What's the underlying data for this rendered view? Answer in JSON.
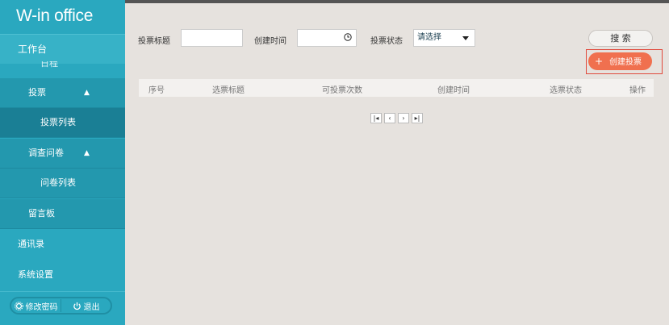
{
  "sidebar": {
    "logo": "W-in office",
    "top_item": "工作台",
    "cut_item": "日程",
    "vote_section": {
      "label": "投票",
      "arrow": "▲"
    },
    "vote_list": "投票列表",
    "survey_section": {
      "label": "调查问卷",
      "arrow": "▲"
    },
    "survey_list": "问卷列表",
    "message_board": "留言板",
    "contacts": "通讯录",
    "settings": "系统设置",
    "footer": {
      "change_password": "修改密码",
      "logout": "退出"
    }
  },
  "filters": {
    "title_label": "投票标题",
    "title_value": "",
    "time_label": "创建时间",
    "time_value": "",
    "status_label": "投票状态",
    "status_selected": "请选择"
  },
  "actions": {
    "search": "搜 索",
    "create_plus": "+",
    "create": "创建投票"
  },
  "table": {
    "columns": [
      "序号",
      "选票标题",
      "可投票次数",
      "创建时间",
      "选票状态",
      "操作"
    ]
  },
  "pager": {
    "first": "|◂",
    "prev": "‹",
    "next": "›",
    "last": "▸|"
  },
  "colors": {
    "sidebar": "#2aa8bf",
    "active": "#1a7f95",
    "accent": "#f0704f",
    "outline": "#e0493b"
  }
}
